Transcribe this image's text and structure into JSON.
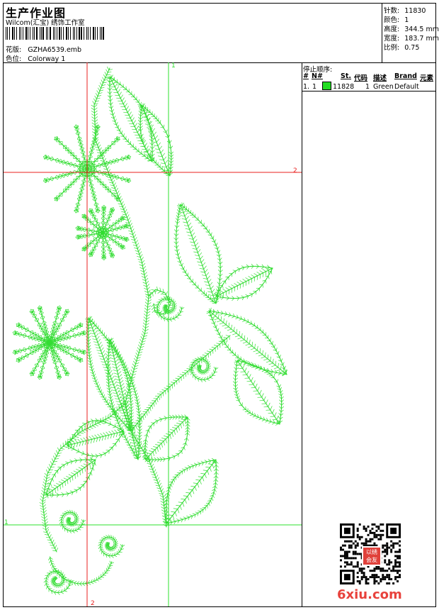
{
  "header": {
    "title": "生产作业图",
    "subtitle": "Wilcom(汇宝) 绣饰工作室",
    "design_file_label": "花版:",
    "design_file": "GZHA6539.emb",
    "colorway_label": "色位:",
    "colorway": "Colorway 1"
  },
  "stats": {
    "stitches_label": "针数:",
    "stitches": "11830",
    "colors_label": "颜色:",
    "colors": "1",
    "height_label": "高度:",
    "height": "344.5 mm",
    "width_label": "宽度:",
    "width": "183.7 mm",
    "scale_label": "比例:",
    "scale": "0.75"
  },
  "stop_sequence": {
    "title": "停止顺序:",
    "columns": [
      "#",
      "N#",
      "St.",
      "代码",
      "描述",
      "Brand",
      "元素"
    ],
    "rows": [
      {
        "num": "1.",
        "n": "1",
        "color": "#22dd22",
        "stitches": "11828",
        "code": "1",
        "desc": "Green",
        "brand": "Default"
      }
    ]
  },
  "guides": {
    "red_v_label": "2",
    "red_h_label": "2",
    "green_v_label": "1",
    "green_h_label": "1"
  },
  "watermark": {
    "text": "6xiu.com",
    "seal_text": "以绣会友"
  },
  "colors": {
    "thread": "#33dd33",
    "guide_red": "#e8201f",
    "guide_green": "#2ee02e"
  }
}
